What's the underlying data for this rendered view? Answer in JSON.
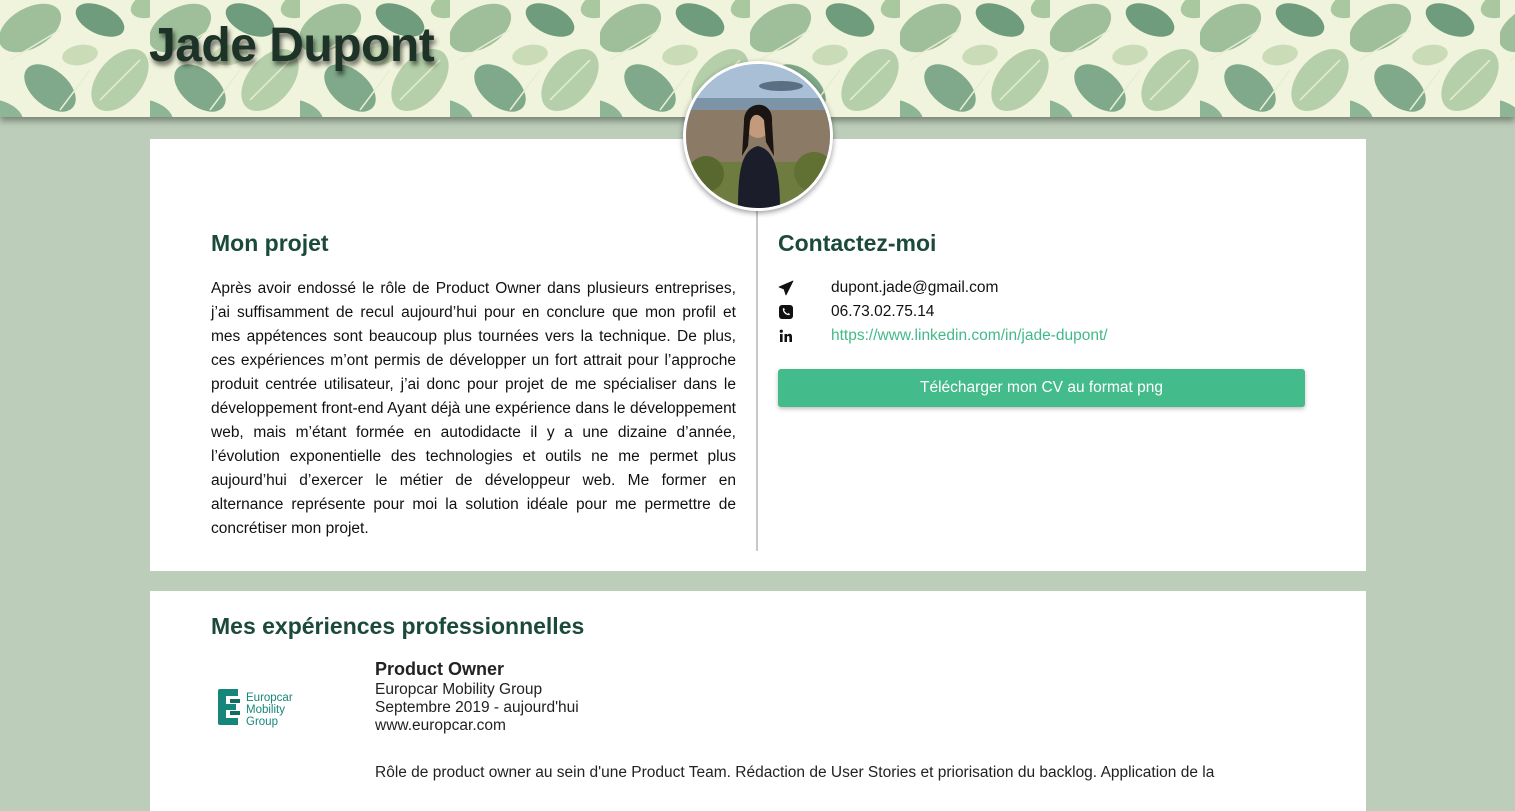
{
  "header": {
    "name": "Jade Dupont"
  },
  "project": {
    "title": "Mon projet",
    "text": "Après avoir endossé le rôle de Product Owner dans plusieurs entreprises, j’ai suffisamment de recul aujourd’hui pour en conclure que mon profil et mes appétences sont beaucoup plus tournées vers la technique. De plus, ces expériences m’ont permis de développer un fort attrait pour l’approche produit centrée utilisateur, j’ai donc pour projet de me spécialiser dans le développement front-end Ayant déjà une expérience dans le développement web, mais m’étant formée en autodidacte il y a une dizaine d’année, l’évolution exponentielle des technologies et outils ne me permet plus aujourd’hui d’exercer le métier de développeur web. Me former en alternance représente pour moi la solution idéale pour me permettre de concrétiser mon projet."
  },
  "contact": {
    "title": "Contactez-moi",
    "email": "dupont.jade@gmail.com",
    "phone": "06.73.02.75.14",
    "linkedin": "https://www.linkedin.com/in/jade-dupont/",
    "email_icon": "paper-plane-icon",
    "phone_icon": "phone-icon",
    "linkedin_icon": "linkedin-icon",
    "cv_button": "Télécharger mon CV au format png"
  },
  "experiences": {
    "title": "Mes expériences professionnelles",
    "items": [
      {
        "role": "Product Owner",
        "company": "Europcar Mobility Group",
        "period": "Septembre 2019 - aujourd'hui",
        "website": "www.europcar.com",
        "logo_lines": [
          "Europcar",
          "Mobility",
          "Group"
        ],
        "description": "Rôle de product owner au sein d'une Product Team. Rédaction de User Stories et priorisation du backlog. Application de la"
      }
    ]
  },
  "colors": {
    "accent": "#43bb8a",
    "heading": "#1c4a3a",
    "background": "#bccdb9",
    "logo_teal": "#16867a"
  }
}
